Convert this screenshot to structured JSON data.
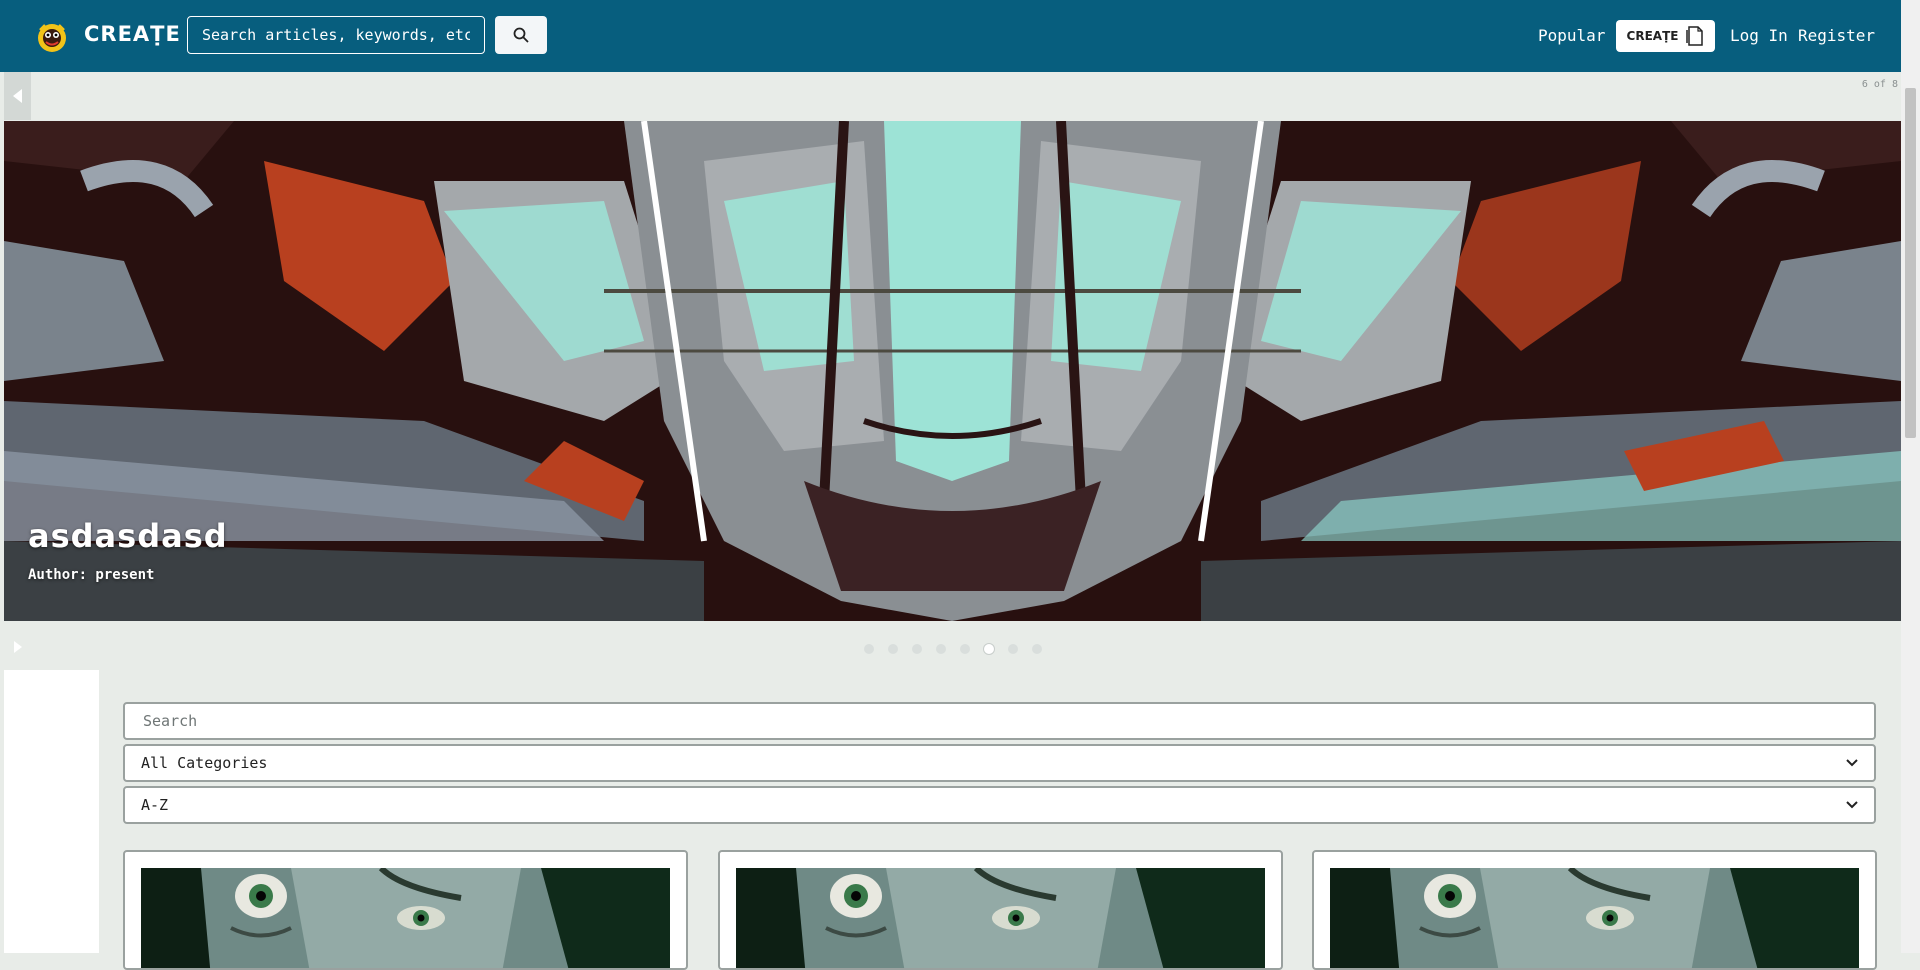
{
  "navbar": {
    "brand": "CREAṬE",
    "search_placeholder": "Search articles, keywords, etc",
    "popular_label": "Popular",
    "create_label": "CREAṬE",
    "login_label": "Log In",
    "register_label": "Register",
    "accent": "#075e7e"
  },
  "carousel": {
    "counter": "6 of 8",
    "slide_title": "asdasdasd",
    "slide_author": "Author: present",
    "total_slides": 8,
    "active_slide": 6
  },
  "filters": {
    "search_placeholder": "Search",
    "category_selected": "All Categories",
    "sort_selected": "A-Z"
  },
  "cards": [
    {
      "image": "joker-face"
    },
    {
      "image": "joker-face"
    },
    {
      "image": "joker-face"
    }
  ]
}
